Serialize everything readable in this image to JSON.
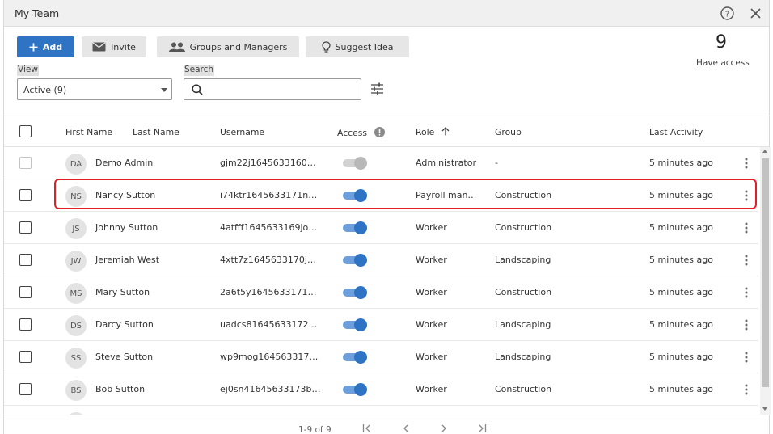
{
  "window": {
    "title": "My Team"
  },
  "toolbar": {
    "add_label": "Add",
    "invite_label": "Invite",
    "groups_label": "Groups and Managers",
    "suggest_label": "Suggest Idea"
  },
  "stats": {
    "count": "9",
    "label": "Have access"
  },
  "filters": {
    "view_label": "View",
    "view_value": "Active (9)",
    "search_label": "Search",
    "search_placeholder": ""
  },
  "table": {
    "headers": {
      "first_name": "First Name",
      "last_name": "Last Name",
      "username": "Username",
      "access": "Access",
      "role": "Role",
      "group": "Group",
      "last_activity": "Last Activity"
    },
    "rows": [
      {
        "initials": "DA",
        "name": "Demo Admin",
        "username": "gjm22j1645633160…",
        "access": false,
        "role": "Administrator",
        "group": "-",
        "last_activity": "5 minutes ago",
        "checkbox_disabled": true
      },
      {
        "initials": "NS",
        "name": "Nancy Sutton",
        "username": "i74ktr1645633171n…",
        "access": true,
        "role": "Payroll man…",
        "group": "Construction",
        "last_activity": "5 minutes ago",
        "checkbox_disabled": false
      },
      {
        "initials": "JS",
        "name": "Johnny Sutton",
        "username": "4atfff1645633169jo…",
        "access": true,
        "role": "Worker",
        "group": "Construction",
        "last_activity": "5 minutes ago",
        "checkbox_disabled": false
      },
      {
        "initials": "JW",
        "name": "Jeremiah West",
        "username": "4xtt7z1645633170j…",
        "access": true,
        "role": "Worker",
        "group": "Landscaping",
        "last_activity": "5 minutes ago",
        "checkbox_disabled": false
      },
      {
        "initials": "MS",
        "name": "Mary Sutton",
        "username": "2a6t5y1645633171…",
        "access": true,
        "role": "Worker",
        "group": "Construction",
        "last_activity": "5 minutes ago",
        "checkbox_disabled": false
      },
      {
        "initials": "DS",
        "name": "Darcy Sutton",
        "username": "uadcs81645633172…",
        "access": true,
        "role": "Worker",
        "group": "Landscaping",
        "last_activity": "5 minutes ago",
        "checkbox_disabled": false
      },
      {
        "initials": "SS",
        "name": "Steve Sutton",
        "username": "wp9mog164563317…",
        "access": true,
        "role": "Worker",
        "group": "Landscaping",
        "last_activity": "5 minutes ago",
        "checkbox_disabled": false
      },
      {
        "initials": "BS",
        "name": "Bob Sutton",
        "username": "ej0sn41645633173b…",
        "access": true,
        "role": "Worker",
        "group": "Construction",
        "last_activity": "5 minutes ago",
        "checkbox_disabled": false
      }
    ]
  },
  "pagination": {
    "text": "1-9 of 9"
  },
  "colors": {
    "primary": "#2f73c4",
    "toggle_track": "#6d9fdc",
    "highlight": "#e01f26"
  },
  "icons": [
    "help-icon",
    "close-icon",
    "plus-icon",
    "envelope-icon",
    "people-icon",
    "lightbulb-icon",
    "search-icon",
    "filter-sliders-icon",
    "info-icon",
    "sort-arrow-up-icon",
    "more-vertical-icon"
  ]
}
